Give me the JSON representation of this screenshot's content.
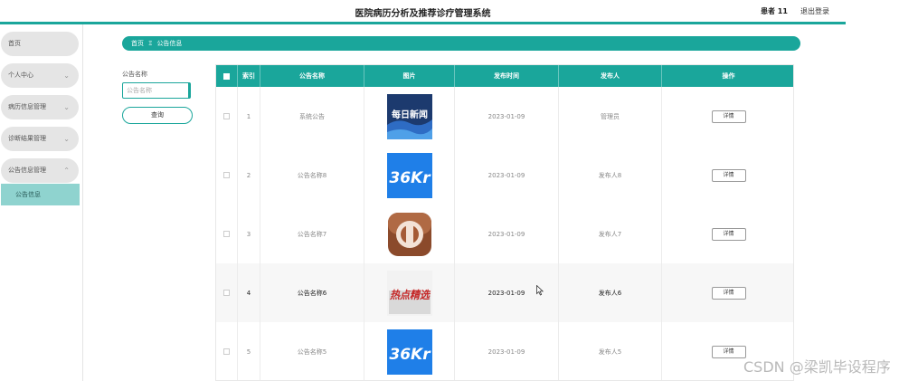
{
  "header": {
    "title": "医院病历分析及推荐诊疗管理系统",
    "user": "患者 11",
    "logout": "退出登录"
  },
  "sidebar": {
    "items": [
      {
        "label": "首页",
        "chevron": ""
      },
      {
        "label": "个人中心",
        "chevron": "⌄"
      },
      {
        "label": "病历信息管理",
        "chevron": "⌄"
      },
      {
        "label": "诊断结果管理",
        "chevron": "⌄"
      },
      {
        "label": "公告信息管理",
        "chevron": "⌃"
      }
    ],
    "sub_active": "公告信息"
  },
  "breadcrumb": {
    "home": "首页",
    "separator": "Ξ",
    "current": "公告信息"
  },
  "filter": {
    "label": "公告名称",
    "placeholder": "公告名称",
    "search_label": "查询"
  },
  "table": {
    "headers": {
      "index": "索引",
      "name": "公告名称",
      "image": "图片",
      "time": "发布时间",
      "publisher": "发布人",
      "action": "操作"
    },
    "rows": [
      {
        "index": "1",
        "name": "系统公告",
        "time": "2023-01-09",
        "publisher": "管理员",
        "action": "详情",
        "image_text": "每日新闻"
      },
      {
        "index": "2",
        "name": "公告名称8",
        "time": "2023-01-09",
        "publisher": "发布人8",
        "action": "详情",
        "image_text": "36Kr"
      },
      {
        "index": "3",
        "name": "公告名称7",
        "time": "2023-01-09",
        "publisher": "发布人7",
        "action": "详情",
        "image_text": ""
      },
      {
        "index": "4",
        "name": "公告名称6",
        "time": "2023-01-09",
        "publisher": "发布人6",
        "action": "详情",
        "image_text": "热点精选"
      },
      {
        "index": "5",
        "name": "公告名称5",
        "time": "2023-01-09",
        "publisher": "发布人5",
        "action": "详情",
        "image_text": "36Kr"
      }
    ]
  },
  "watermark": "CSDN @梁凯毕设程序",
  "colors": {
    "accent": "#1aa69b",
    "sidebar_active": "#8fd3cf",
    "sidebar_item": "#e5e5e5"
  }
}
